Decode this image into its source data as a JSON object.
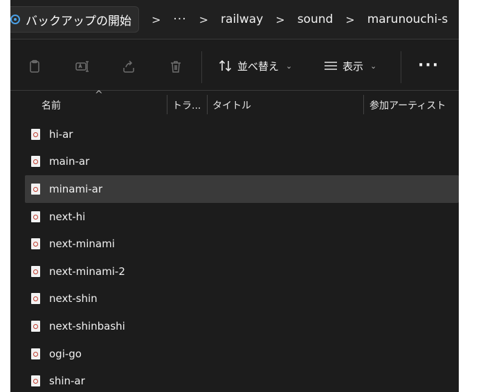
{
  "addressbar": {
    "first_crumb": "バックアップの開始",
    "ellipsis": "···",
    "crumbs": [
      "railway",
      "sound",
      "marunouchi-s"
    ],
    "separator": ">"
  },
  "toolbar": {
    "icons": [
      "new-icon",
      "rename-icon",
      "share-icon",
      "delete-icon"
    ],
    "sort_label": "並べ替え",
    "view_label": "表示",
    "more_label": "···"
  },
  "columns": {
    "name": "名前",
    "track": "トラ...",
    "title": "タイトル",
    "artist": "参加アーティスト"
  },
  "files": [
    {
      "name": "hi-ar",
      "selected": false
    },
    {
      "name": "main-ar",
      "selected": false
    },
    {
      "name": "minami-ar",
      "selected": true
    },
    {
      "name": "next-hi",
      "selected": false
    },
    {
      "name": "next-minami",
      "selected": false
    },
    {
      "name": "next-minami-2",
      "selected": false
    },
    {
      "name": "next-shin",
      "selected": false
    },
    {
      "name": "next-shinbashi",
      "selected": false
    },
    {
      "name": "ogi-go",
      "selected": false
    },
    {
      "name": "shin-ar",
      "selected": false
    }
  ],
  "colors": {
    "window_bg": "#1c1c1c",
    "selection_bg": "#3a3a3a",
    "file_icon_accent": "#c0392b",
    "drive_icon_accent": "#4aa0e6"
  }
}
